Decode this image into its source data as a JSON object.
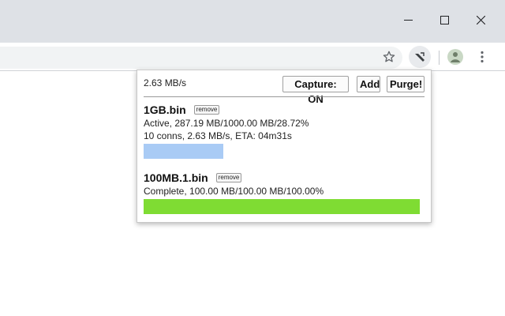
{
  "window": {
    "minimize_icon": "minimize-icon",
    "maximize_icon": "maximize-icon",
    "close_icon": "close-icon"
  },
  "toolbar": {
    "star_icon": "star-icon",
    "extension_icon": "extension-icon",
    "avatar_icon": "avatar-icon",
    "menu_icon": "kebab-menu-icon"
  },
  "popup": {
    "speed": "2.63 MB/s",
    "capture_label": "Capture: ON",
    "add_label": "Add",
    "purge_label": "Purge!",
    "downloads": [
      {
        "name": "1GB.bin",
        "remove_label": "remove",
        "status_line": "Active, 287.19 MB/1000.00 MB/28.72%",
        "detail_line": "10 conns, 2.63 MB/s, ETA: 04m31s",
        "progress": 0.2872,
        "bar_color": "#a9cbf5"
      },
      {
        "name": "100MB.1.bin",
        "remove_label": "remove",
        "status_line": "Complete, 100.00 MB/100.00 MB/100.00%",
        "progress": 1.0,
        "bar_color": "#7fdc33"
      }
    ]
  }
}
